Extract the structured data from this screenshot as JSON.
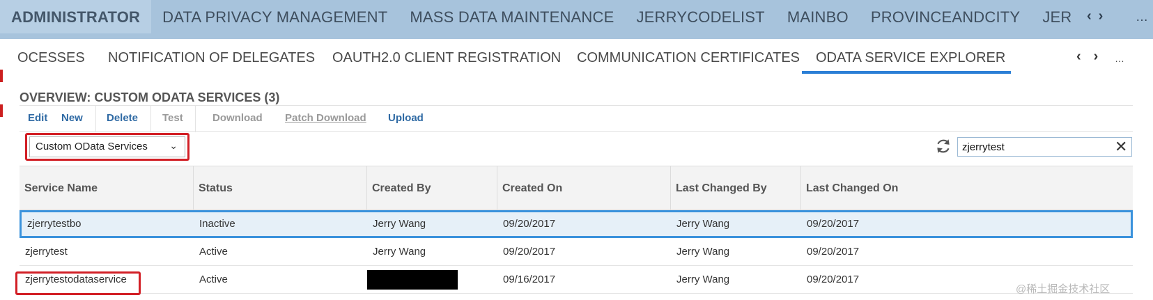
{
  "topnav": {
    "tabs": [
      {
        "label": "ADMINISTRATOR",
        "active": true
      },
      {
        "label": "DATA PRIVACY MANAGEMENT",
        "active": false
      },
      {
        "label": "MASS DATA MAINTENANCE",
        "active": false
      },
      {
        "label": "JERRYCODELIST",
        "active": false
      },
      {
        "label": "MAINBO",
        "active": false
      },
      {
        "label": "PROVINCEANDCITY",
        "active": false
      },
      {
        "label": "JER",
        "active": false
      }
    ],
    "prev_glyph": "‹",
    "next_glyph": "›",
    "more_glyph": "…",
    "fade_glyph": "‹ ‹"
  },
  "subtabs": {
    "tabs": [
      {
        "label": "OCESSES",
        "active": false
      },
      {
        "label": "NOTIFICATION OF DELEGATES",
        "active": false
      },
      {
        "label": "OAUTH2.0 CLIENT REGISTRATION",
        "active": false
      },
      {
        "label": "COMMUNICATION CERTIFICATES",
        "active": false
      },
      {
        "label": "ODATA SERVICE EXPLORER",
        "active": true
      }
    ],
    "prev_glyph": "‹",
    "next_glyph": "›",
    "more_glyph": "…"
  },
  "overview": {
    "title": "OVERVIEW: CUSTOM ODATA SERVICES (3)"
  },
  "toolbar": {
    "buttons": [
      {
        "label": "Edit",
        "enabled": true
      },
      {
        "label": "New",
        "enabled": true
      },
      {
        "label": "Delete",
        "enabled": true
      },
      {
        "label": "Test",
        "enabled": false
      },
      {
        "label": "Download",
        "enabled": false
      },
      {
        "label": "Patch Download",
        "enabled": false
      },
      {
        "label": "Upload",
        "enabled": true
      }
    ]
  },
  "filter": {
    "selected": "Custom OData Services",
    "search_value": "zjerrytest",
    "clear_glyph": "✕",
    "dropdown_glyph": "⌄"
  },
  "table": {
    "columns": [
      "Service Name",
      "Status",
      "Created By",
      "Created On",
      "Last Changed By",
      "Last Changed On"
    ],
    "rows": [
      {
        "service_name": "zjerrytestbo",
        "status": "Inactive",
        "created_by": "Jerry Wang",
        "created_on": "09/20/2017",
        "last_changed_by": "Jerry Wang",
        "last_changed_on": "09/20/2017",
        "selected": true
      },
      {
        "service_name": "zjerrytest",
        "status": "Active",
        "created_by": "Jerry Wang",
        "created_on": "09/20/2017",
        "last_changed_by": "Jerry Wang",
        "last_changed_on": "09/20/2017",
        "selected": false
      },
      {
        "service_name": "zjerrytestodataservice",
        "status": "Active",
        "created_by": "",
        "created_on": "09/16/2017",
        "last_changed_by": "Jerry Wang",
        "last_changed_on": "09/20/2017",
        "selected": false,
        "created_by_redacted": true
      }
    ]
  },
  "watermark": "@稀土掘金技术社区",
  "colors": {
    "topnav_bg": "#a7c3dc",
    "link_blue": "#2f6aa4",
    "active_underline": "#2b7fd6",
    "highlight_red": "#d21f26",
    "selected_row_border": "#3a92dc"
  }
}
